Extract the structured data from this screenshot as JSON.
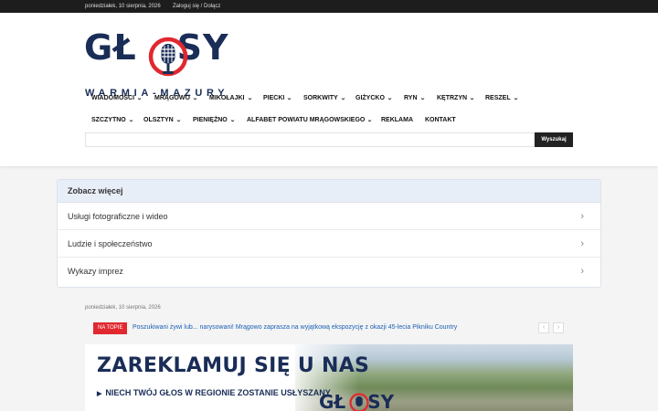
{
  "topbar": {
    "date": "poniedziałek, 10 sierpnia, 2026",
    "login": "Zaloguj się / Dołącz"
  },
  "logo": {
    "word_left": "GŁ",
    "word_right": "SY",
    "subtitle": "WARMIA-MAZURY",
    "mic_icon": "microphone-icon",
    "colors": {
      "navy": "#1a2d57",
      "red": "#e1282f"
    }
  },
  "nav": {
    "row1": [
      {
        "label": "WIADOMOŚCI",
        "dropdown": true
      },
      {
        "label": "MRĄGOWO",
        "dropdown": true
      },
      {
        "label": "MIKOŁAJKI",
        "dropdown": true
      },
      {
        "label": "PIECKI",
        "dropdown": true
      },
      {
        "label": "SORKWITY",
        "dropdown": true
      },
      {
        "label": "GIŻYCKO",
        "dropdown": true
      },
      {
        "label": "RYN",
        "dropdown": true
      },
      {
        "label": "KĘTRZYN",
        "dropdown": true
      },
      {
        "label": "RESZEL",
        "dropdown": true
      }
    ],
    "row2": [
      {
        "label": "SZCZYTNO",
        "dropdown": true
      },
      {
        "label": "OLSZTYN",
        "dropdown": true
      },
      {
        "label": "PIENIĘŻNO",
        "dropdown": true
      },
      {
        "label": "ALFABET POWIATU MRĄGOWSKIEGO",
        "dropdown": true
      },
      {
        "label": "REKLAMA",
        "dropdown": false
      },
      {
        "label": "KONTAKT",
        "dropdown": false
      }
    ],
    "chevron": "⌄"
  },
  "search": {
    "value": "",
    "button": "Wyszukaj"
  },
  "see_more": {
    "heading": "Zobacz więcej",
    "items": [
      "Usługi fotograficzne i wideo",
      "Ludzie i społeczeństwo",
      "Wykazy imprez"
    ],
    "arrow": "›"
  },
  "content": {
    "date": "poniedziałek, 10 sierpnia, 2026",
    "ticker": {
      "badge": "NA TOPIE",
      "text": "Poszukiwani żywi lub... narysowani! Mrągowo zaprasza na wyjątkową ekspozycję z okazji 45-lecia Pikniku Country",
      "prev": "‹",
      "next": "›"
    },
    "ad": {
      "title": "ZAREKLAMUJ SIĘ U NAS",
      "subtitle": "NIECH TWÓJ GŁOS W REGIONIE ZOSTANIE USŁYSZANY",
      "bullet": "▶",
      "logo_left": "GŁ",
      "logo_right": "SY"
    }
  }
}
